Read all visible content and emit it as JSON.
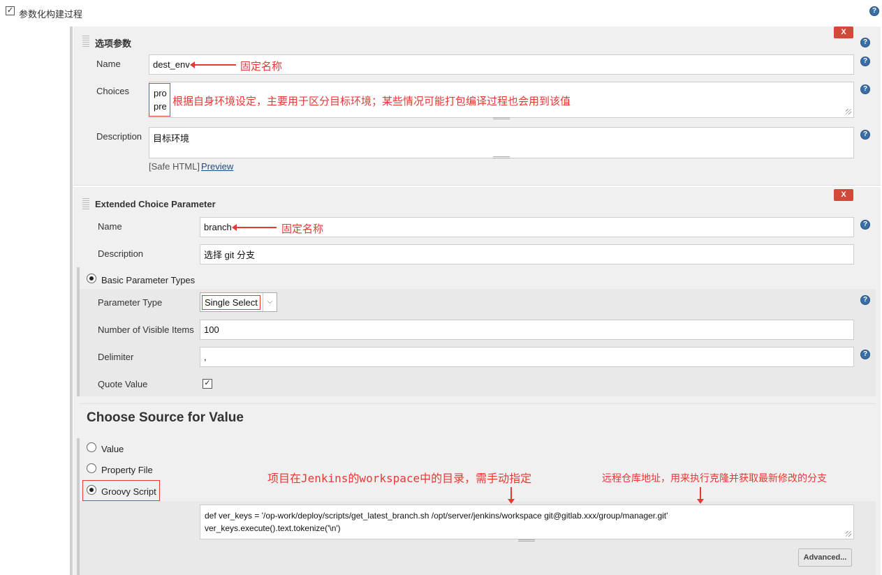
{
  "header": {
    "checkbox_label": "参数化构建过程",
    "checked": true
  },
  "choice_param": {
    "title": "选项参数",
    "delete_label": "X",
    "name_label": "Name",
    "name_value": "dest_env",
    "choices_label": "Choices",
    "choices": [
      "pro",
      "pre"
    ],
    "description_label": "Description",
    "description_value": "目标环境",
    "safe_html": "[Safe HTML]",
    "preview_link": "Preview"
  },
  "extended_param": {
    "title": "Extended Choice Parameter",
    "delete_label": "X",
    "name_label": "Name",
    "name_value": "branch",
    "description_label": "Description",
    "description_value": "选择 git 分支",
    "basic_types_label": "Basic Parameter Types",
    "parameter_type_label": "Parameter Type",
    "parameter_type_value": "Single Select",
    "visible_items_label": "Number of Visible Items",
    "visible_items_value": "100",
    "delimiter_label": "Delimiter",
    "delimiter_value": ",",
    "quote_value_label": "Quote Value",
    "quote_value_checked": true,
    "source_heading": "Choose Source for Value",
    "source_options": [
      "Value",
      "Property File",
      "Groovy Script"
    ],
    "source_selected": "Groovy Script",
    "script_line1": "def ver_keys = '/op-work/deploy/scripts/get_latest_branch.sh /opt/server/jenkins/workspace git@gitlab.xxx/group/manager.git'",
    "script_line2": "ver_keys.execute().text.tokenize('\\n')",
    "advanced_button": "Advanced..."
  },
  "annotations": {
    "fixed_name_1": "固定名称",
    "fixed_name_2": "固定名称",
    "choices_note": "根据自身环境设定，主要用于区分目标环境；某些情况可能打包编译过程也会用到该值",
    "workspace_note": "项目在Jenkins的workspace中的目录，需手动指定",
    "repo_note": "远程仓库地址，用来执行克隆并获取最新修改的分支"
  },
  "colors": {
    "accent_red": "#e53935",
    "help_blue": "#3a6ea5",
    "delete_red": "#d24939"
  }
}
